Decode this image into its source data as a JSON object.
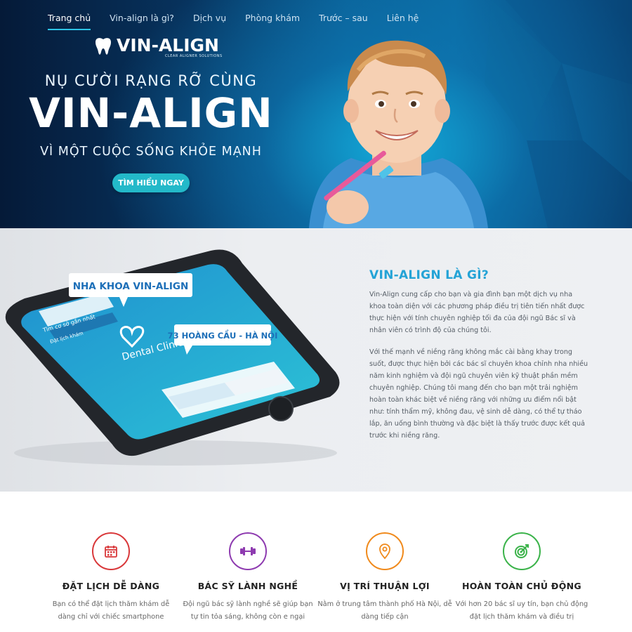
{
  "nav": {
    "items": [
      {
        "label": "Trang chủ",
        "active": true
      },
      {
        "label": "Vin-align là gì?",
        "active": false
      },
      {
        "label": "Dịch vụ",
        "active": false
      },
      {
        "label": "Phòng khám",
        "active": false
      },
      {
        "label": "Trước – sau",
        "active": false
      },
      {
        "label": "Liên hệ",
        "active": false
      }
    ]
  },
  "hero": {
    "logo_text": "VIN-ALIGN",
    "logo_subtitle": "CLEAR ALIGNER SOLUTIONS",
    "line1": "NỤ CƯỜI RẠNG RỠ CÙNG",
    "title": "VIN-ALIGN",
    "line3": "VÌ MỘT CUỘC SỐNG KHỎE MẠNH",
    "cta_label": "TÌM HIỂU NGAY",
    "icons": {
      "logo": "tooth-icon",
      "photo": "smiling-child-toothbrush"
    }
  },
  "about": {
    "phone_bubble1": "NHA KHOA VIN-ALIGN",
    "phone_bubble2": "73 HOÀNG CẦU - HÀ NỘI",
    "phone_screen": {
      "search_text": "Tìm cơ sở gần nhất",
      "menu_text": "Đặt lịch khám",
      "brand": "Dental Clinic"
    },
    "title": "VIN-ALIGN LÀ GÌ?",
    "paragraph1": "Vin-Align cung cấp cho bạn và gia đình bạn một dịch vụ nha khoa toàn diện với các phương pháp điều trị tiên tiến nhất được thực hiện với tính chuyên nghiệp tối đa của đội ngũ Bác sĩ  và nhân viên có trình độ của chúng tôi.",
    "paragraph2": "Với thế mạnh về niềng răng không mắc cài bằng khay trong suốt, được thực hiện bởi các bác sĩ chuyên khoa chỉnh nha nhiều năm kinh nghiệm và đội ngũ chuyên viên kỹ thuật phần mềm chuyên nghiệp. Chúng tôi mang đến cho bạn một trải nghiệm hoàn toàn khác biệt về niềng răng với những ưu điểm nổi bật như: tính thẩm mỹ, không đau, vệ sinh dễ dàng, có thể tự tháo lắp, ăn uống bình thường và đặc biệt là thấy trước được kết quả trước khi niềng răng."
  },
  "features": [
    {
      "icon": "calendar-icon",
      "color": "#d9383a",
      "title": "ĐẶT LỊCH DỄ DÀNG",
      "desc": "Bạn có thể đặt lịch thăm khám dễ dàng chỉ với chiếc smartphone"
    },
    {
      "icon": "dumbbell-icon",
      "color": "#8e3bb0",
      "title": "BÁC SỸ LÀNH NGHỀ",
      "desc": "Đội ngũ bác sỹ lành nghề sẽ giúp bạn tự tin tỏa sáng, không còn e ngại"
    },
    {
      "icon": "map-pin-icon",
      "color": "#f08a1c",
      "title": "VỊ TRÍ THUẬN LỢI",
      "desc": "Nằm ở trung tâm thành phố Hà Nội, dễ dàng tiếp cận"
    },
    {
      "icon": "target-icon",
      "color": "#3bb34a",
      "title": "HOÀN TOÀN CHỦ ĐỘNG",
      "desc": "Với hơn 20 bác sĩ uy tín, bạn chủ động đặt lịch thăm khám và điều trị"
    }
  ],
  "colors": {
    "accent": "#24a3d6",
    "button": "#23b9c9",
    "hero_dark": "#051a38"
  }
}
